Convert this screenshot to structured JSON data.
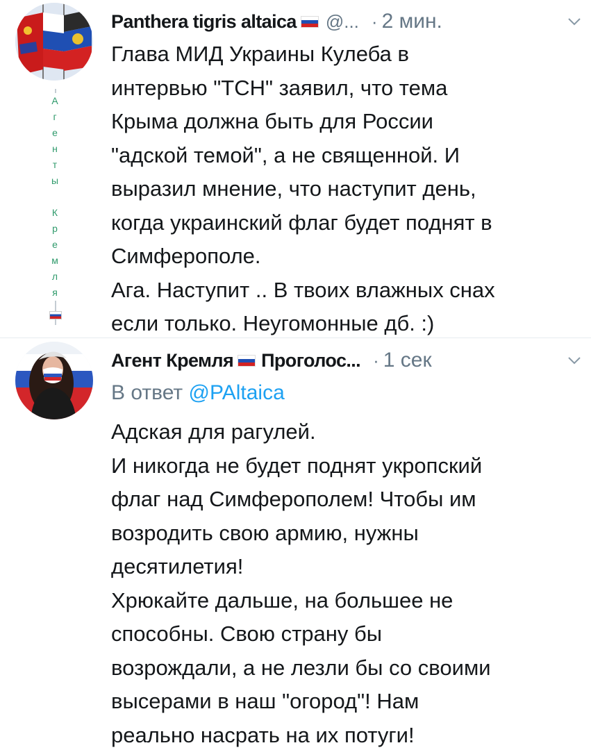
{
  "tweets": [
    {
      "display_name": "Panthera tigris altaica",
      "handle": "@...",
      "time": "2 мин.",
      "vertical_label": [
        "А",
        "г",
        "е",
        "н",
        "т",
        "ы",
        "",
        "К",
        "р",
        "е",
        "м",
        "л",
        "я"
      ],
      "body_lines": [
        "Глава МИД Украины Кулеба в",
        "интервью \"ТСН\" заявил, что тема",
        "Крыма должна быть для России",
        "\"адской темой\", а не священной. И",
        "выразил мнение, что наступит день,",
        "когда украинский флаг будет поднят в",
        "Симферополе.",
        "Ага. Наступит .. В твоих влажных снах",
        "если только. Неугомонные дб. :)"
      ]
    },
    {
      "display_name": "Агент Кремля",
      "display_name_suffix": "Проголос...",
      "time": "1 сек",
      "reply_prefix": "В ответ",
      "reply_mention": "@PAltaica",
      "body_lines": [
        "Адская для рагулей.",
        "И никогда не будет поднят укропский",
        "флаг над Симферополем! Чтобы им",
        "возродить свою армию, нужны",
        "десятилетия!",
        "Хрюкайте дальше, на большее не",
        "способны. Свою страну бы",
        "возрождали, а не лезли бы со своими",
        "высерами в наш \"огород\"! Нам",
        "реально насрать на их потуги!"
      ]
    }
  ],
  "icons": {
    "flag": "russia-flag-icon",
    "menu": "chevron-down-icon"
  },
  "colors": {
    "secondary_text": "#657786",
    "link": "#1da1f2",
    "text": "#14171a"
  }
}
